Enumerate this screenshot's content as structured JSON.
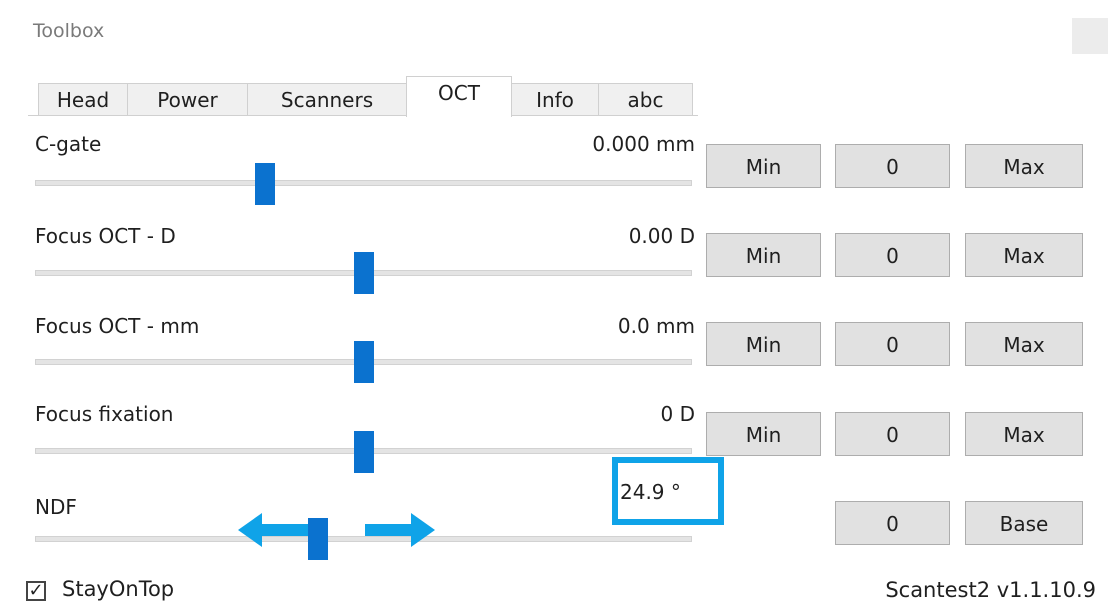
{
  "window": {
    "title": "Toolbox"
  },
  "tabs": [
    {
      "label": "Head"
    },
    {
      "label": "Power"
    },
    {
      "label": "Scanners"
    },
    {
      "label": "OCT"
    },
    {
      "label": "Info"
    },
    {
      "label": "abc"
    }
  ],
  "active_tab": "OCT",
  "controls": [
    {
      "label": "C-gate",
      "value": "0.000 mm",
      "slider_fraction": 0.35,
      "buttons": [
        "Min",
        "0",
        "Max"
      ]
    },
    {
      "label": "Focus OCT - D",
      "value": "0.00 D",
      "slider_fraction": 0.5,
      "buttons": [
        "Min",
        "0",
        "Max"
      ]
    },
    {
      "label": "Focus OCT - mm",
      "value": "0.0 mm",
      "slider_fraction": 0.5,
      "buttons": [
        "Min",
        "0",
        "Max"
      ]
    },
    {
      "label": "Focus fixation",
      "value": "0 D",
      "slider_fraction": 0.5,
      "buttons": [
        "Min",
        "0",
        "Max"
      ]
    },
    {
      "label": "NDF",
      "value": "24.9 °",
      "slider_fraction": 0.43,
      "buttons": [
        "0",
        "Base"
      ]
    }
  ],
  "colors": {
    "accent": "#0b72cf",
    "annotation": "#0fa3e8"
  },
  "footer": {
    "stay_on_top_label": "StayOnTop",
    "stay_on_top_checked": true,
    "checkmark": "✓",
    "version": "Scantest2 v1.1.10.9"
  }
}
